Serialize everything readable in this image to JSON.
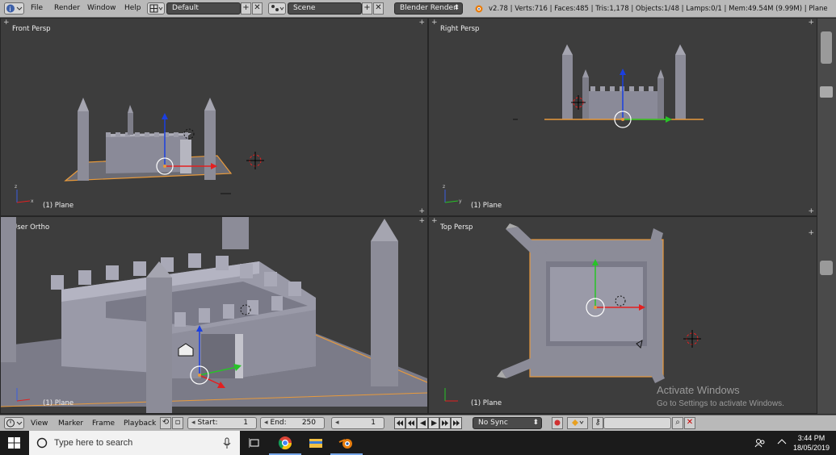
{
  "topbar": {
    "menus": [
      "File",
      "Render",
      "Window",
      "Help"
    ],
    "layout": "Default",
    "scene": "Scene",
    "engine": "Blender Render",
    "stats": "v2.78 | Verts:716 | Faces:485 | Tris:1,178 | Objects:1/48 | Lamps:0/1 | Mem:49.54M (9.99M) | Plane"
  },
  "viewports": {
    "front": {
      "label": "Front Persp",
      "object": "(1) Plane"
    },
    "right": {
      "label": "Right Persp",
      "object": "(1) Plane"
    },
    "user": {
      "label": "User Ortho",
      "object": "(1) Plane"
    },
    "top": {
      "label": "Top Persp",
      "object": "(1) Plane"
    }
  },
  "timeline": {
    "menus": [
      "View",
      "Marker",
      "Frame",
      "Playback"
    ],
    "start_label": "Start:",
    "start_value": "1",
    "end_label": "End:",
    "end_value": "250",
    "current_frame": "1",
    "sync": "No Sync"
  },
  "watermark": {
    "title": "Activate Windows",
    "subtitle": "Go to Settings to activate Windows."
  },
  "taskbar": {
    "search_placeholder": "Type here to search",
    "time": "3:44 PM",
    "date": "18/05/2019"
  },
  "colors": {
    "x_axis": "#e32020",
    "y_axis": "#27c427",
    "z_axis": "#1b3fe0",
    "selection": "#e89a3c"
  }
}
